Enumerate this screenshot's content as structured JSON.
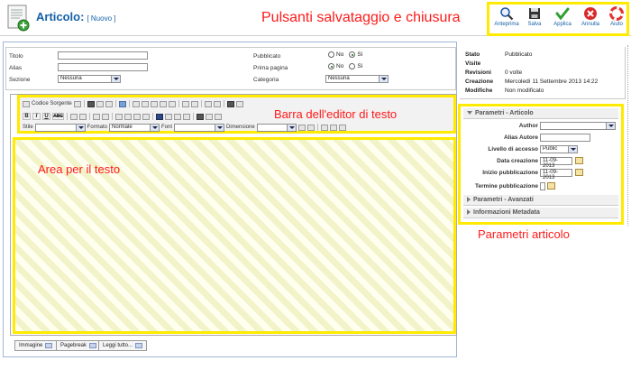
{
  "header": {
    "title": "Articolo:",
    "subtitle": "[ Nuovo ]",
    "annotation": "Pulsanti salvataggio e chiusura"
  },
  "toolbar": {
    "buttons": [
      {
        "label": "Anteprima",
        "icon": "magnifier-icon",
        "color": "#1a4f9c"
      },
      {
        "label": "Salva",
        "icon": "floppy-icon",
        "color": "#333333"
      },
      {
        "label": "Applica",
        "icon": "checkmark-icon",
        "color": "#2e9e2e"
      },
      {
        "label": "Annulla",
        "icon": "cancel-icon",
        "color": "#d92b2b"
      },
      {
        "label": "Aiuto",
        "icon": "lifebuoy-icon",
        "color": "#e3322f"
      }
    ]
  },
  "form": {
    "title_label": "Titolo",
    "alias_label": "Alias",
    "sezione_label": "Sezione",
    "sezione_value": "Nessuna",
    "pubblicato_label": "Pubblicato",
    "primapagina_label": "Prima pagina",
    "categoria_label": "Categoria",
    "categoria_value": "Nessuna",
    "no_label": "No",
    "si_label": "Sì"
  },
  "editor": {
    "annotation_toolbar": "Barra dell'editor di testo",
    "annotation_area": "Area per il testo",
    "codice_sorgente": "Codice Sorgente",
    "stile_label": "Stile",
    "formato_label": "Formato",
    "formato_value": "Normale",
    "font_label": "Font",
    "dimensione_label": "Dimensione",
    "bold": "B",
    "italic": "I",
    "underline": "U",
    "strike": "ABC"
  },
  "bottom_buttons": [
    "Immagine",
    "Pagebreak",
    "Leggi tutto..."
  ],
  "info": {
    "stato_label": "Stato",
    "stato_value": "Pubblicato",
    "visite_label": "Visite",
    "visite_value": "",
    "revisioni_label": "Revisioni",
    "revisioni_value": "0 volte",
    "creazione_label": "Creazione",
    "creazione_value": "Mercoledì 11 Settembre 2013 14:22",
    "modifiche_label": "Modifiche",
    "modifiche_value": "Non modificato"
  },
  "params": {
    "section1": "Parametri - Articolo",
    "author_label": "Author",
    "alias_autore_label": "Alias Autore",
    "livello_label": "Livello di accesso",
    "livello_value": "Public",
    "data_creazione_label": "Data creazione",
    "data_creazione_value": "11-09-2013",
    "inizio_label": "Inizio pubblicazione",
    "inizio_value": "11-09-2013",
    "termine_label": "Termine pubblicazione",
    "section2": "Parametri - Avanzati",
    "section3": "Informazioni Metadata",
    "annotation": "Parametri articolo"
  }
}
